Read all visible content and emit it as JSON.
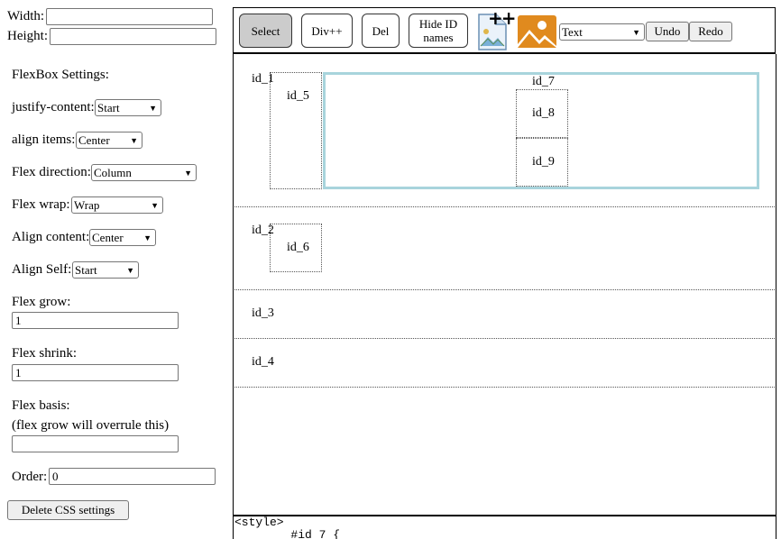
{
  "size": {
    "width_label": "Width:",
    "height_label": "Height:",
    "width_value": "",
    "height_value": ""
  },
  "flex": {
    "heading": "FlexBox Settings:",
    "justify_label": "justify-content:",
    "justify_value": "Start",
    "align_items_label": "align items:",
    "align_items_value": "Center",
    "direction_label": "Flex direction:",
    "direction_value": "Column",
    "wrap_label": "Flex wrap:",
    "wrap_value": "Wrap",
    "align_content_label": "Align content:",
    "align_content_value": "Center",
    "align_self_label": "Align Self:",
    "align_self_value": "Start",
    "grow_label": "Flex grow:",
    "grow_value": "1",
    "shrink_label": "Flex shrink:",
    "shrink_value": "1",
    "basis_label": "Flex basis:",
    "basis_note": "(flex grow will overrule this)",
    "basis_value": "",
    "order_label": "Order:",
    "order_value": "0",
    "delete_button": "Delete CSS settings"
  },
  "toolbar": {
    "select": "Select",
    "div": "Div++",
    "del": "Del",
    "hide_line1": "Hide ID",
    "hide_line2": "names",
    "img_plus": "++",
    "type_value": "Text",
    "undo": "Undo",
    "redo": "Redo"
  },
  "canvas": {
    "ids": [
      "id_1",
      "id_2",
      "id_3",
      "id_4",
      "id_5",
      "id_6",
      "id_7",
      "id_8",
      "id_9"
    ]
  },
  "code": {
    "line1": "<style>",
    "line2": "        #id_7 {"
  },
  "colors": {
    "selected_border": "#a8d4dc",
    "active_button": "#cccccc",
    "image_orange": "#e08a1e"
  }
}
